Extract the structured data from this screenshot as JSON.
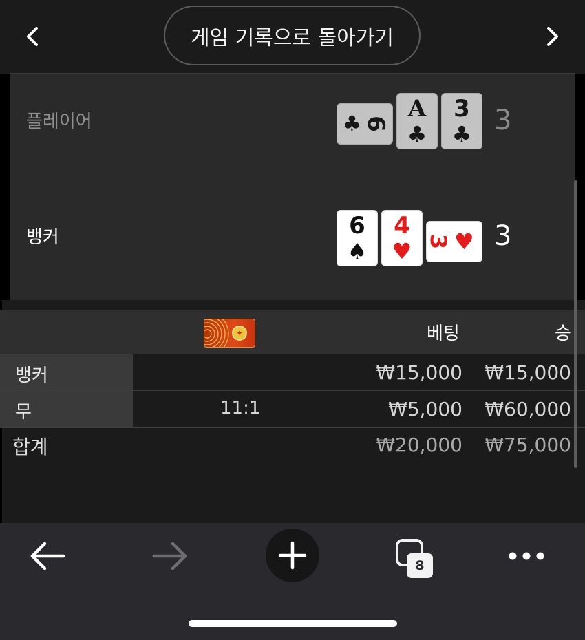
{
  "header": {
    "back_to_history_label": "게임 기록으로 돌아가기",
    "prev_icon": "chevron-left-icon",
    "next_icon": "chevron-right-icon"
  },
  "result": {
    "player": {
      "label": "플레이어",
      "total": "3",
      "cards": [
        {
          "rank": "6",
          "suit": "♣",
          "orientation": "sideways",
          "color": "black"
        },
        {
          "rank": "A",
          "suit": "♣",
          "orientation": "upright",
          "color": "black"
        },
        {
          "rank": "3",
          "suit": "♣",
          "orientation": "upright",
          "color": "black"
        }
      ]
    },
    "banker": {
      "label": "뱅커",
      "total": "3",
      "cards": [
        {
          "rank": "6",
          "suit": "♠",
          "orientation": "upright",
          "color": "black"
        },
        {
          "rank": "4",
          "suit": "♥",
          "orientation": "upright",
          "color": "red"
        },
        {
          "rank": "3",
          "suit": "♥",
          "orientation": "sideways",
          "color": "red"
        }
      ]
    }
  },
  "bet_table": {
    "headers": {
      "bonus_icon": "red-envelope-bonus-icon",
      "bet": "베팅",
      "win": "승"
    },
    "rows": [
      {
        "name": "뱅커",
        "odds": "",
        "bet": "₩15,000",
        "win": "₩15,000"
      },
      {
        "name": "무",
        "odds": "11:1",
        "bet": "₩5,000",
        "win": "₩60,000"
      }
    ],
    "total": {
      "name": "합계",
      "bet": "₩20,000",
      "win": "₩75,000"
    }
  },
  "browser_toolbar": {
    "back_icon": "arrow-left-icon",
    "forward_icon": "arrow-right-icon",
    "new_tab_icon": "plus-icon",
    "tabs_icon": "tabs-icon",
    "tab_count": "8",
    "more_icon": "more-dots-icon"
  },
  "colors": {
    "background": "#1b1b1b",
    "panel": "#2a2a2a",
    "red_suit": "#e41b1b",
    "toolbar": "#2a2a2e"
  }
}
